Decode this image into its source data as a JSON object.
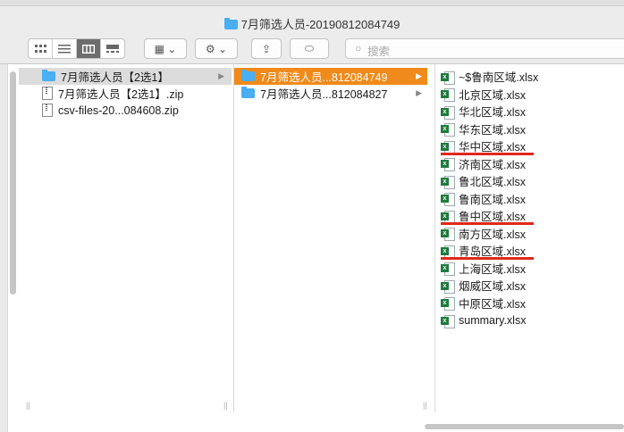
{
  "window": {
    "title": "7月筛选人员-20190812084749"
  },
  "toolbar": {
    "view_buttons": [
      "icon-view-icon",
      "list-view-icon",
      "column-view-icon",
      "gallery-view-icon"
    ],
    "arrange_label": "▦ ⌄",
    "action_label": "⚙ ⌄",
    "share_label": "⇪",
    "tag_label": "⬭",
    "search_placeholder": "搜索"
  },
  "column1": [
    {
      "name": "7月筛选人员【2选1】",
      "type": "folder",
      "selected": "gray"
    },
    {
      "name": "7月筛选人员【2选1】.zip",
      "type": "zip"
    },
    {
      "name": "csv-files-20...084608.zip",
      "type": "zip"
    }
  ],
  "column2": [
    {
      "name": "7月筛选人员...812084749",
      "type": "folder",
      "selected": "orange"
    },
    {
      "name": "7月筛选人员...812084827",
      "type": "folder"
    }
  ],
  "column3": [
    {
      "name": "~$鲁南区域.xlsx",
      "underlined": false
    },
    {
      "name": "北京区域.xlsx",
      "underlined": false
    },
    {
      "name": "华北区域.xlsx",
      "underlined": false
    },
    {
      "name": "华东区域.xlsx",
      "underlined": false
    },
    {
      "name": "华中区域.xlsx",
      "underlined": true
    },
    {
      "name": "济南区域.xlsx",
      "underlined": false
    },
    {
      "name": "鲁北区域.xlsx",
      "underlined": false
    },
    {
      "name": "鲁南区域.xlsx",
      "underlined": false
    },
    {
      "name": "鲁中区域.xlsx",
      "underlined": true
    },
    {
      "name": "南方区域.xlsx",
      "underlined": false
    },
    {
      "name": "青岛区域.xlsx",
      "underlined": true
    },
    {
      "name": "上海区域.xlsx",
      "underlined": false
    },
    {
      "name": "烟威区域.xlsx",
      "underlined": false
    },
    {
      "name": "中原区域.xlsx",
      "underlined": false
    },
    {
      "name": "summary.xlsx",
      "underlined": false
    }
  ],
  "colors": {
    "folder": "#49aef2",
    "selection": "#f08a1a",
    "annotation": "#e0281b",
    "excel": "#1f7a3d"
  }
}
